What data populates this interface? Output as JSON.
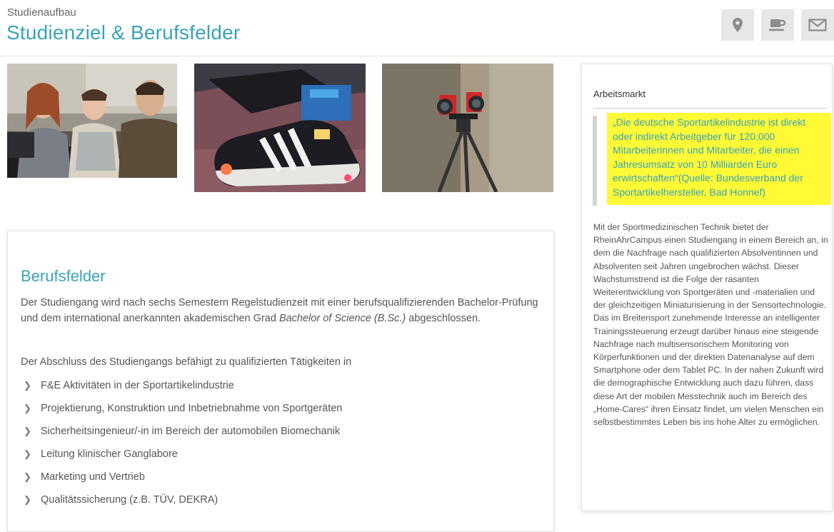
{
  "header": {
    "breadcrumb": "Studienaufbau",
    "title": "Studienziel & Berufsfelder",
    "tools": [
      {
        "icon": "location-pin-icon"
      },
      {
        "icon": "coffee-cup-icon"
      },
      {
        "icon": "envelope-icon"
      }
    ]
  },
  "colors": {
    "accent": "#3aa3b8",
    "highlight": "#fffa35"
  },
  "main": {
    "heading": "Berufsfelder",
    "paragraph1_before": "Der Studiengang wird nach sechs Semestern Regelstudienzeit mit einer berufsqualifizierenden Bachelor-Prüfung und dem international anerkannten akademischen Grad ",
    "paragraph1_degree": "Bachelor of Science (B.Sc.)",
    "paragraph1_after": " abgeschlossen.",
    "paragraph2": "Der Abschluss des Studiengangs befähigt zu qualifizierten Tätigkeiten in",
    "list": [
      "F&E Aktivitäten in der Sportartikelindustrie",
      "Projektierung, Konstruktion und Inbetriebnahme von Sportgeräten",
      "Sicherheitsingenieur/-in im Bereich der automobilen Biomechanik",
      "Leitung klinischer Ganglabore",
      "Marketing und Vertrieb",
      "Qualitätssicherung (z.B. TÜV, DEKRA)"
    ]
  },
  "sidebar": {
    "title": "Arbeitsmarkt",
    "quote": "„Die deutsche Sportartikelindustrie ist direkt oder indirekt Arbeitgeber für 120.000 Mitarbeiterinnen und Mitarbeiter, die einen Jahresumsatz von 10 Milliarden Euro erwirtschaften“(Quelle: Bundesverband der Sportartikelhersteller, Bad Honnef)",
    "body": "Mit der Sportmedizinischen Technik bietet der RheinAhrCampus einen Studiengang in einem Bereich an, in dem die Nachfrage nach qualifizierten Absolventinnen und Absolventen seit Jahren ungebrochen wächst. Dieser Wachstumstrend ist die Folge der rasanten Weiterentwicklung von Sportgeräten und -materialien und der gleichzeitigen Miniaturisierung in der Sensortechnologie. Das im Breitensport zunehmende Interesse an intelligenter Trainingssteuerung erzeugt darüber hinaus eine steigende Nachfrage nach multisensorischem Monitoring von Körperfunktionen und der direkten Datenanalyse auf dem Smartphone oder dem Tablet PC. In der nahen Zukunft wird die demographische Entwicklung auch dazu führen, dass diese Art der mobilen Messtechnik auch im Bereich des „Home-Cares“ ihren Einsatz findet, um vielen Menschen ein selbstbestimmtes Leben bis ins hohe Alter zu ermöglichen."
  }
}
